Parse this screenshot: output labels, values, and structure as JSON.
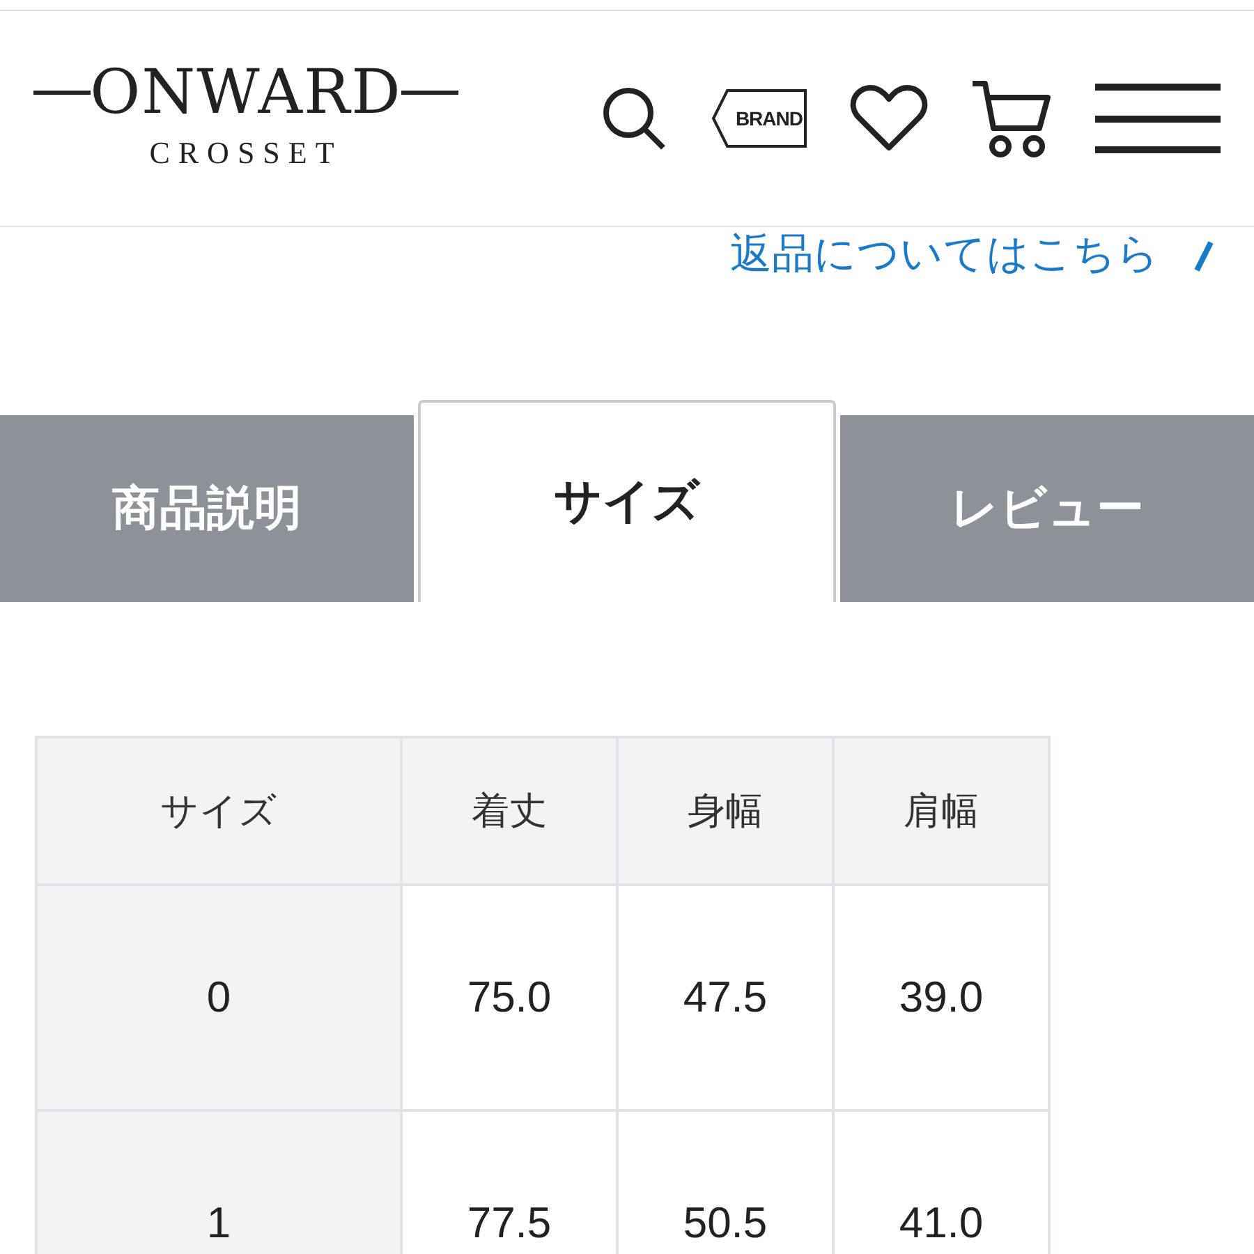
{
  "header": {
    "logo": {
      "wordmark": "ONWARD",
      "sub": "CROSSET"
    },
    "brand_label": "BRAND"
  },
  "return_link": {
    "label": "返品についてはこちら"
  },
  "tabs": [
    {
      "label": "商品説明",
      "selected": false
    },
    {
      "label": "サイズ",
      "selected": true
    },
    {
      "label": "レビュー",
      "selected": false
    }
  ],
  "size_table": {
    "columns": [
      "サイズ",
      "着丈",
      "身幅",
      "肩幅"
    ],
    "rows": [
      [
        "0",
        "75.0",
        "47.5",
        "39.0"
      ],
      [
        "1",
        "77.5",
        "50.5",
        "41.0"
      ]
    ]
  }
}
